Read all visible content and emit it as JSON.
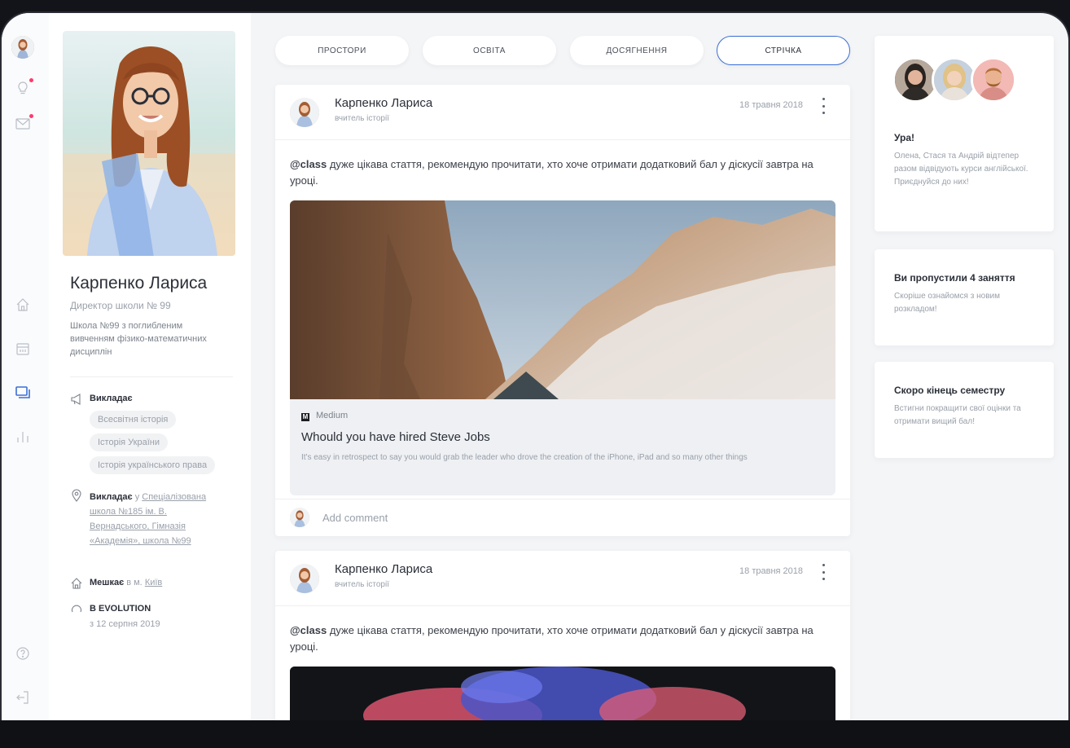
{
  "tabs": [
    {
      "label": "ПРОСТОРИ",
      "active": false
    },
    {
      "label": "ОСВІТА",
      "active": false
    },
    {
      "label": "ДОСЯГНЕННЯ",
      "active": false
    },
    {
      "label": "СТРІЧКА",
      "active": true
    }
  ],
  "profile": {
    "name": "Карпенко Лариса",
    "role": "Директор школи № 99",
    "school": "Школа №99 з поглибленим вивченням фізико-математичних дисциплін",
    "teaches_label": "Викладає",
    "subjects": [
      "Всесвітня історія",
      "Історія України",
      "Історія українського права"
    ],
    "works_label": "Викладає",
    "works_prep": "у",
    "works_places": "Спеціалізована школа №185 ім. В. Вернадського, Гімназія «Академія», школа №99",
    "lives_label": "Мешкає",
    "lives_prep": "в м.",
    "lives_city": "Київ",
    "evolution_label": "В EVOLUTION",
    "evolution_since": "з 12 серпня 2019"
  },
  "posts": [
    {
      "author": "Карпенко Лариса",
      "author_role": "вчитель історії",
      "date": "18 травня 2018",
      "mention": "@class",
      "text": " дуже цікава стаття, рекомендую прочитати, хто хоче отримати додатковий бал у діскусії завтра на уроці.",
      "link_card": {
        "source": "Medium",
        "title": "Whould you have hired Steve Jobs",
        "description": "It's easy in retrospect to say you would grab the leader who drove the creation of the iPhone, iPad and so many other things"
      },
      "comment_placeholder": "Add comment"
    },
    {
      "author": "Карпенко Лариса",
      "author_role": "вчитель історії",
      "date": "18 травня 2018",
      "mention": "@class",
      "text": " дуже цікава стаття, рекомендую прочитати, хто хоче отримати додатковий бал у діскусії завтра на уроці."
    }
  ],
  "notifications": [
    {
      "title": "Ура!",
      "body": "Олена, Стася та Андрій відтепер разом відвідують курси англійської. Приєднуйся до них!"
    },
    {
      "title": "Ви пропустили 4 заняття",
      "body": "Скоріше ознайомся з новим розкладом!"
    },
    {
      "title": "Скоро кінець семестру",
      "body": "Встигни покращити свої оцінки та отримати вищий бал!"
    }
  ],
  "rail_icons": [
    "bulb-icon",
    "mail-icon",
    "home-icon",
    "calendar-icon",
    "courses-icon",
    "stats-icon",
    "help-icon",
    "logout-icon"
  ],
  "colors": {
    "accent": "#3b6fd6",
    "notification_dot": "#ff3b6b",
    "background": "#f4f5f7"
  }
}
